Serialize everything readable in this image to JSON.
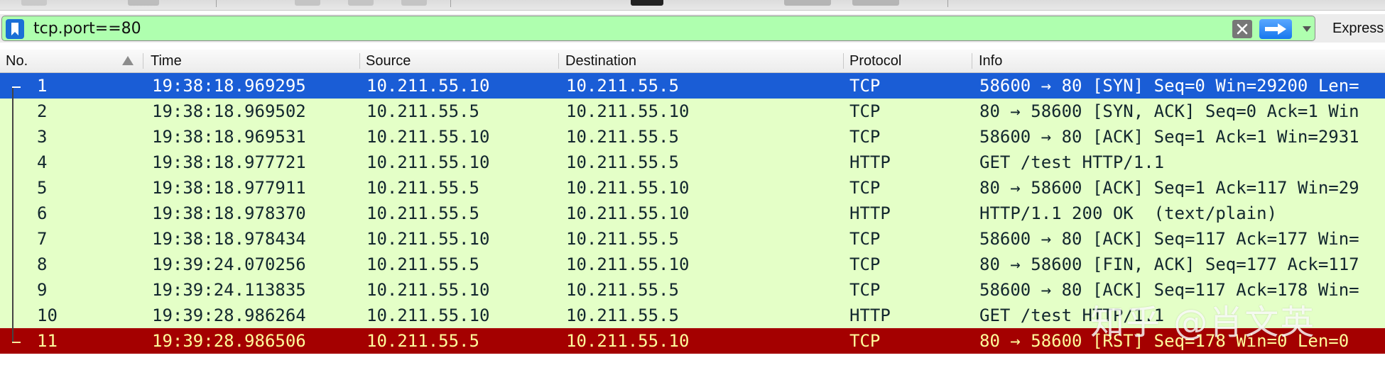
{
  "filter": {
    "value": "tcp.port==80",
    "expression_label": "Express"
  },
  "columns": [
    "No.",
    "Time",
    "Source",
    "Destination",
    "Protocol",
    "Info"
  ],
  "packets": [
    {
      "no": "1",
      "time": "19:38:18.969295",
      "src": "10.211.55.10",
      "dst": "10.211.55.5",
      "proto": "TCP",
      "info": "58600 → 80 [SYN] Seq=0 Win=29200 Len=",
      "style": "selected"
    },
    {
      "no": "2",
      "time": "19:38:18.969502",
      "src": "10.211.55.5",
      "dst": "10.211.55.10",
      "proto": "TCP",
      "info": "80 → 58600 [SYN, ACK] Seq=0 Ack=1 Win",
      "style": "normal"
    },
    {
      "no": "3",
      "time": "19:38:18.969531",
      "src": "10.211.55.10",
      "dst": "10.211.55.5",
      "proto": "TCP",
      "info": "58600 → 80 [ACK] Seq=1 Ack=1 Win=2931",
      "style": "normal"
    },
    {
      "no": "4",
      "time": "19:38:18.977721",
      "src": "10.211.55.10",
      "dst": "10.211.55.5",
      "proto": "HTTP",
      "info": "GET /test HTTP/1.1",
      "style": "normal"
    },
    {
      "no": "5",
      "time": "19:38:18.977911",
      "src": "10.211.55.5",
      "dst": "10.211.55.10",
      "proto": "TCP",
      "info": "80 → 58600 [ACK] Seq=1 Ack=117 Win=29",
      "style": "normal"
    },
    {
      "no": "6",
      "time": "19:38:18.978370",
      "src": "10.211.55.5",
      "dst": "10.211.55.10",
      "proto": "HTTP",
      "info": "HTTP/1.1 200 OK  (text/plain)",
      "style": "normal"
    },
    {
      "no": "7",
      "time": "19:38:18.978434",
      "src": "10.211.55.10",
      "dst": "10.211.55.5",
      "proto": "TCP",
      "info": "58600 → 80 [ACK] Seq=117 Ack=177 Win=",
      "style": "normal"
    },
    {
      "no": "8",
      "time": "19:39:24.070256",
      "src": "10.211.55.5",
      "dst": "10.211.55.10",
      "proto": "TCP",
      "info": "80 → 58600 [FIN, ACK] Seq=177 Ack=117",
      "style": "normal"
    },
    {
      "no": "9",
      "time": "19:39:24.113835",
      "src": "10.211.55.10",
      "dst": "10.211.55.5",
      "proto": "TCP",
      "info": "58600 → 80 [ACK] Seq=117 Ack=178 Win=",
      "style": "normal"
    },
    {
      "no": "10",
      "time": "19:39:28.986264",
      "src": "10.211.55.10",
      "dst": "10.211.55.5",
      "proto": "HTTP",
      "info": "GET /test HTTP/1.1",
      "style": "normal"
    },
    {
      "no": "11",
      "time": "19:39:28.986506",
      "src": "10.211.55.5",
      "dst": "10.211.55.10",
      "proto": "TCP",
      "info": "80 → 58600 [RST] Seq=178 Win=0 Len=0",
      "style": "rst"
    }
  ],
  "watermark": "知乎 @肖文英",
  "colors": {
    "filter_valid_bg": "#afffaf",
    "row_tcp_http_bg": "#e4ffc7",
    "row_selected_bg": "#1a5dd6",
    "row_rst_bg": "#a40000",
    "row_rst_fg": "#fffc9c"
  },
  "icons": [
    "bookmark-icon",
    "clear-filter-icon",
    "apply-filter-arrow-icon",
    "filter-history-dropdown-icon",
    "sort-ascending-icon"
  ]
}
